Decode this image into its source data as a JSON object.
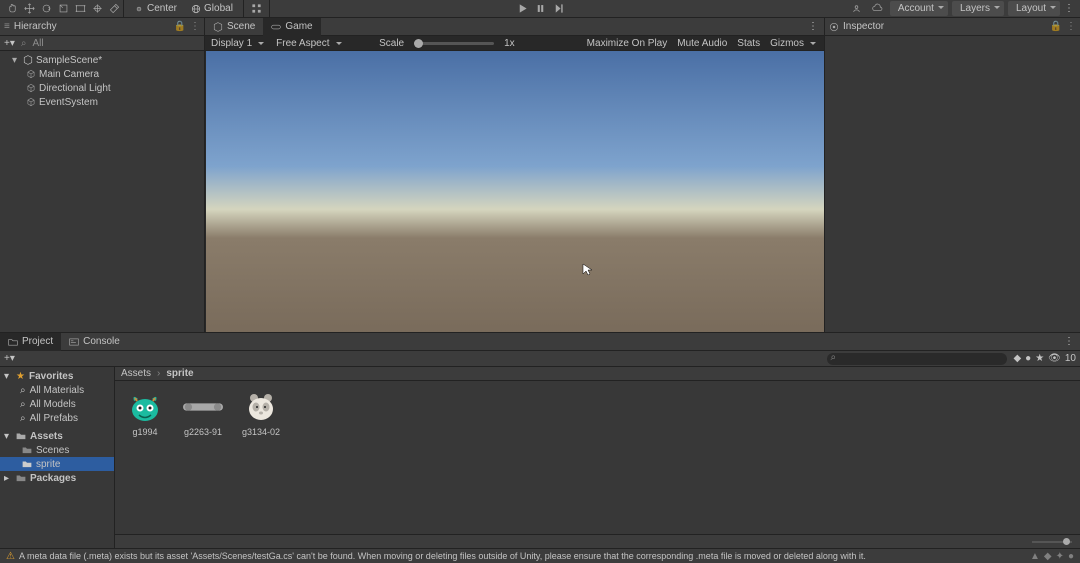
{
  "toolbar": {
    "center_label": "Center",
    "global_label": "Global",
    "account_label": "Account",
    "layers_label": "Layers",
    "layout_label": "Layout"
  },
  "hierarchy": {
    "title": "Hierarchy",
    "search_label": "All",
    "scene_name": "SampleScene*",
    "items": [
      "Main Camera",
      "Directional Light",
      "EventSystem"
    ]
  },
  "scene": {
    "tab_scene": "Scene",
    "tab_game": "Game",
    "display_dd": "Display 1",
    "aspect_dd": "Free Aspect",
    "scale_label": "Scale",
    "scale_value": "1x",
    "maximize": "Maximize On Play",
    "mute": "Mute Audio",
    "stats": "Stats",
    "gizmos": "Gizmos"
  },
  "inspector": {
    "title": "Inspector"
  },
  "project": {
    "tab_project": "Project",
    "tab_console": "Console",
    "favorites": "Favorites",
    "fav_items": [
      "All Materials",
      "All Models",
      "All Prefabs"
    ],
    "assets_root": "Assets",
    "folders": [
      "Scenes",
      "sprite"
    ],
    "packages": "Packages",
    "breadcrumb": [
      "Assets",
      "sprite"
    ],
    "assets": [
      {
        "name": "g1994",
        "icon": "monster"
      },
      {
        "name": "g2263-91",
        "icon": "strip"
      },
      {
        "name": "g3134-02",
        "icon": "panda"
      }
    ],
    "count_badge": "10"
  },
  "footer": {
    "warning": "A meta data file (.meta) exists but its asset 'Assets/Scenes/testGa.cs' can't be found. When moving or deleting files outside of Unity, please ensure that the corresponding .meta file is moved or deleted along with it."
  }
}
